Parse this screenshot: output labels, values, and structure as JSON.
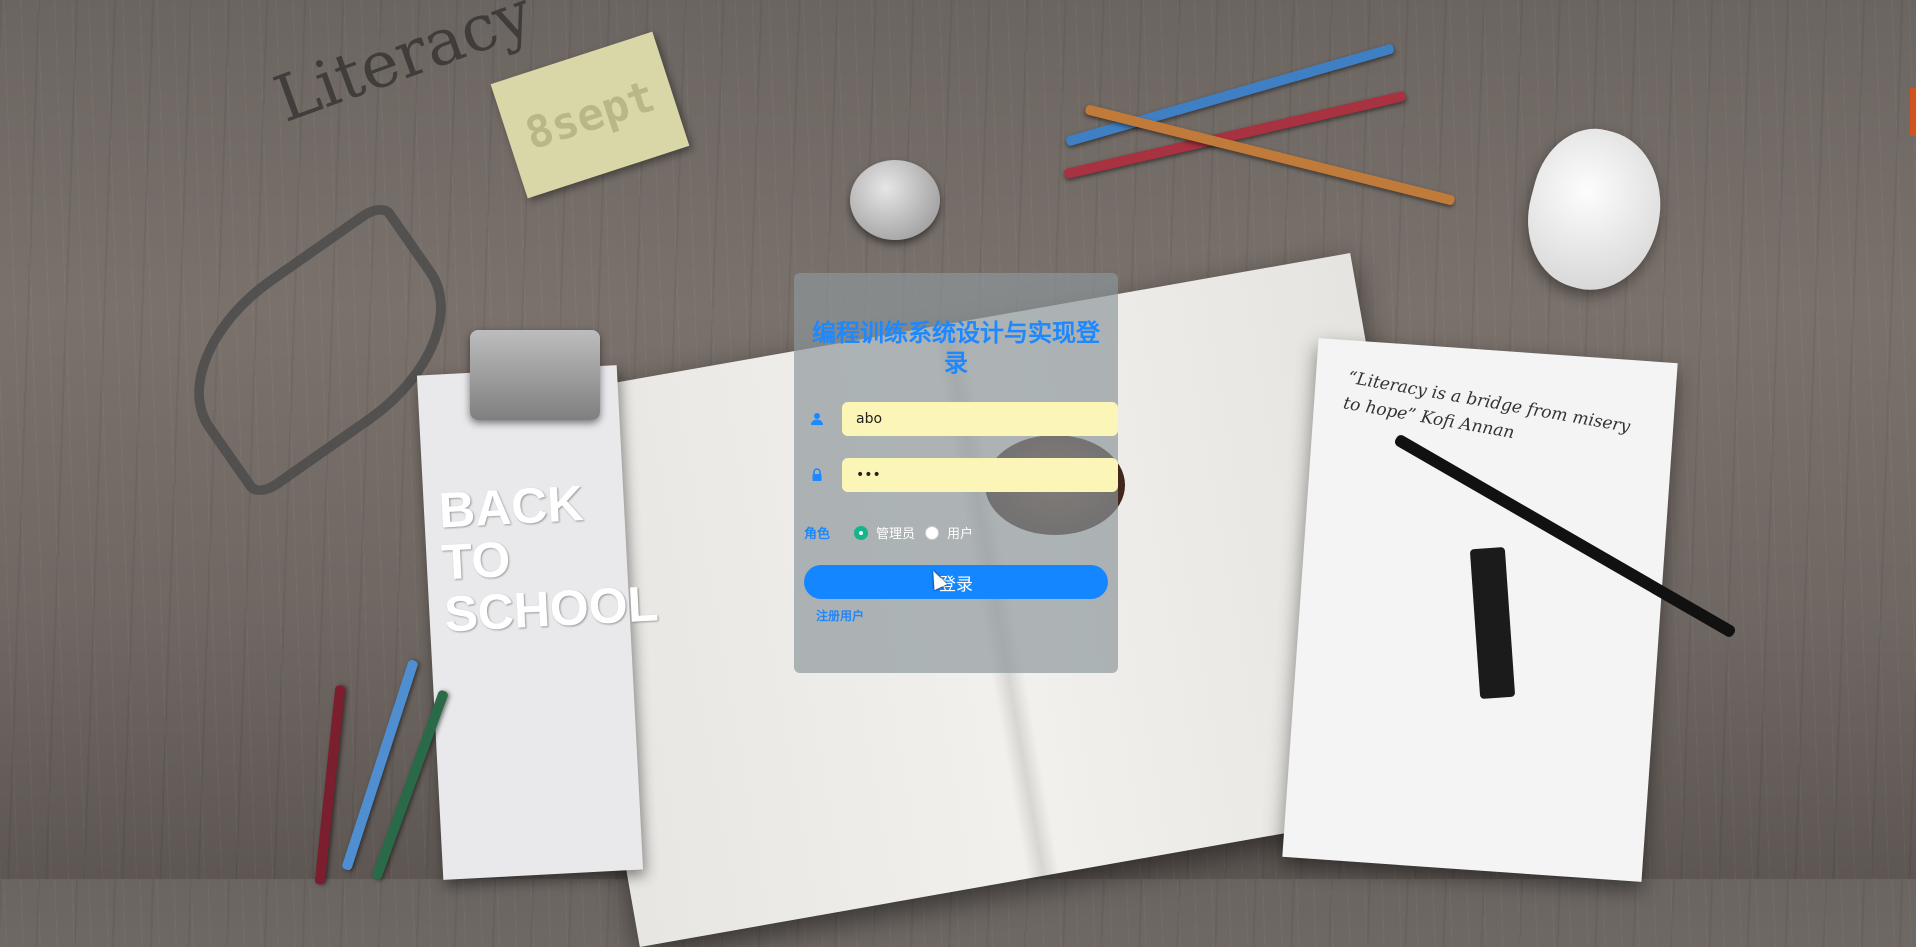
{
  "background": {
    "note_text": "8sept",
    "handwriting_text": "Literacy",
    "clip_card_text": [
      "BACK",
      "TO",
      "SCHOOL"
    ],
    "notepad_quote": "“Literacy is a bridge from misery to hope” Kofi Annan"
  },
  "login": {
    "title": "编程训练系统设计与实现登录",
    "username": {
      "value": "abo",
      "icon": "user-icon"
    },
    "password": {
      "value": "•••",
      "icon": "lock-icon"
    },
    "role": {
      "label": "角色",
      "options": [
        {
          "label": "管理员",
          "selected": true
        },
        {
          "label": "用户",
          "selected": false
        }
      ]
    },
    "submit_label": "登录",
    "register_label": "注册用户"
  },
  "colors": {
    "accent": "#1e88ff",
    "input_bg": "#fbf6b8",
    "radio_selected": "#13b58c"
  }
}
